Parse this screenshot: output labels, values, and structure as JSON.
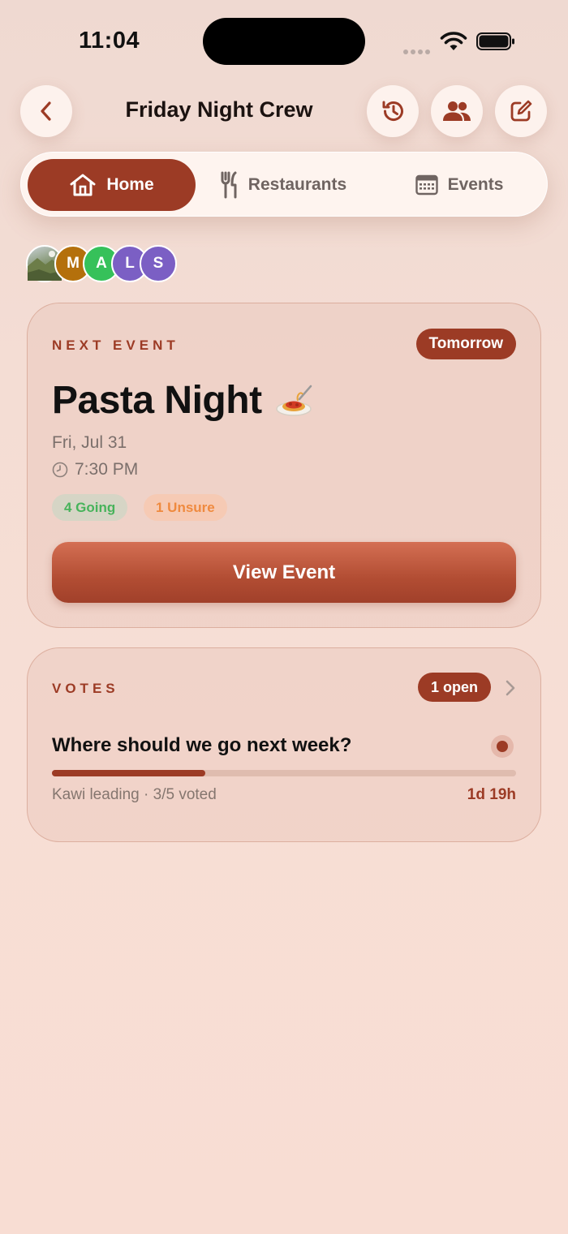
{
  "status": {
    "time": "11:04"
  },
  "header": {
    "title": "Friday Night Crew"
  },
  "tabs": [
    {
      "label": "Home",
      "icon": "home-icon",
      "active": true
    },
    {
      "label": "Restaurants",
      "icon": "fork-knife-icon",
      "active": false
    },
    {
      "label": "Events",
      "icon": "calendar-icon",
      "active": false
    }
  ],
  "members": [
    {
      "initial": "",
      "kind": "photo"
    },
    {
      "initial": "M",
      "color": "#b4700c"
    },
    {
      "initial": "A",
      "color": "#36c15a"
    },
    {
      "initial": "L",
      "color": "#7b5fc4"
    },
    {
      "initial": "S",
      "color": "#7b5fc4"
    }
  ],
  "next_event": {
    "section_label": "NEXT EVENT",
    "badge": "Tomorrow",
    "title": "Pasta Night",
    "date": "Fri, Jul 31",
    "time": "7:30 PM",
    "going": "4 Going",
    "unsure": "1 Unsure",
    "button": "View Event"
  },
  "votes": {
    "section_label": "VOTES",
    "badge": "1 open",
    "question": "Where should we go next week?",
    "progress": 0.33,
    "meta": "Kawi leading · 3/5 voted",
    "remaining": "1d 19h"
  },
  "colors": {
    "accent": "#9c3b25",
    "going": "#47b35b",
    "unsure": "#ef8a3f"
  }
}
